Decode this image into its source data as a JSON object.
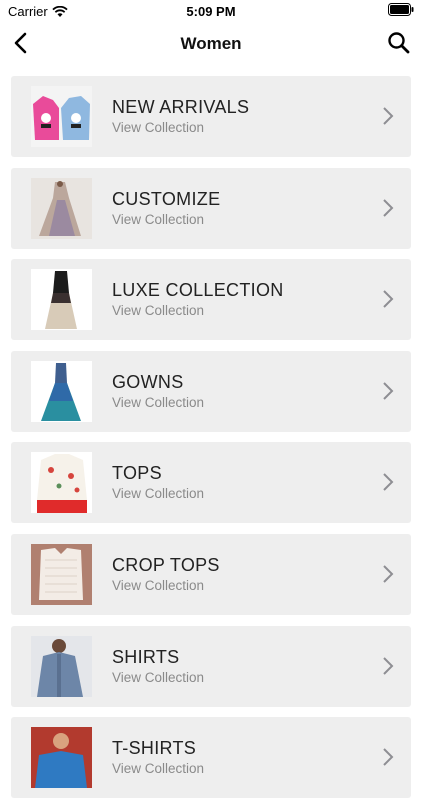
{
  "status_bar": {
    "carrier": "Carrier",
    "time": "5:09 PM"
  },
  "nav": {
    "title": "Women",
    "back_icon": "chevron-left-icon",
    "search_icon": "search-icon"
  },
  "collections": [
    {
      "title": "NEW ARRIVALS",
      "subtitle": "View Collection"
    },
    {
      "title": "CUSTOMIZE",
      "subtitle": "View Collection"
    },
    {
      "title": "LUXE COLLECTION",
      "subtitle": "View Collection"
    },
    {
      "title": "GOWNS",
      "subtitle": "View Collection"
    },
    {
      "title": "TOPS",
      "subtitle": "View Collection"
    },
    {
      "title": "CROP TOPS",
      "subtitle": "View Collection"
    },
    {
      "title": "SHIRTS",
      "subtitle": "View Collection"
    },
    {
      "title": "T-SHIRTS",
      "subtitle": "View Collection"
    }
  ],
  "colors": {
    "card_bg": "#eeeeee",
    "subtitle": "#8a8a8a",
    "chevron": "#8e8e93"
  }
}
